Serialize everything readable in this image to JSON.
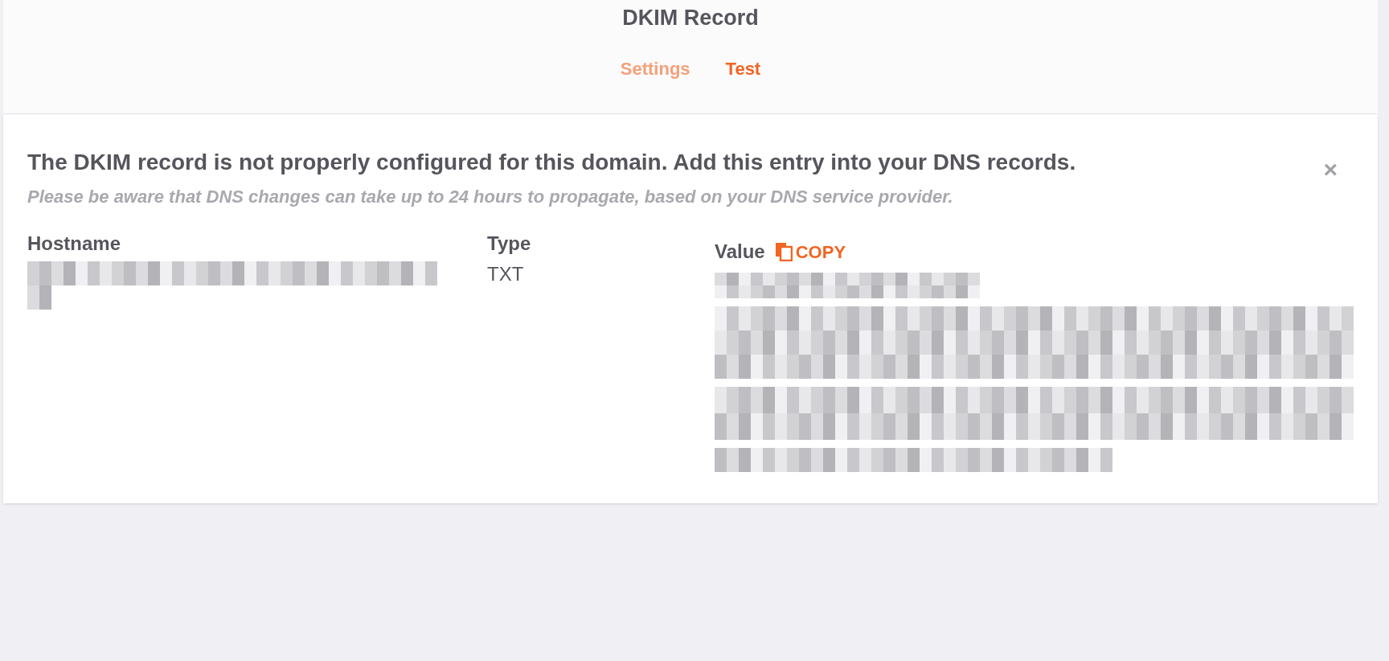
{
  "header": {
    "title": "DKIM Record"
  },
  "tabs": [
    {
      "label": "Settings",
      "selected": false
    },
    {
      "label": "Test",
      "selected": true
    }
  ],
  "alert": {
    "message": "The DKIM record is not properly configured for this domain. Add this entry into your DNS records.",
    "note": "Please be aware that DNS changes can take up to 24 hours to propagate, based on your DNS service provider.",
    "close": "×"
  },
  "record": {
    "hostname_label": "Hostname",
    "type_label": "Type",
    "type_value": "TXT",
    "value_label": "Value",
    "copy": "COPY"
  }
}
